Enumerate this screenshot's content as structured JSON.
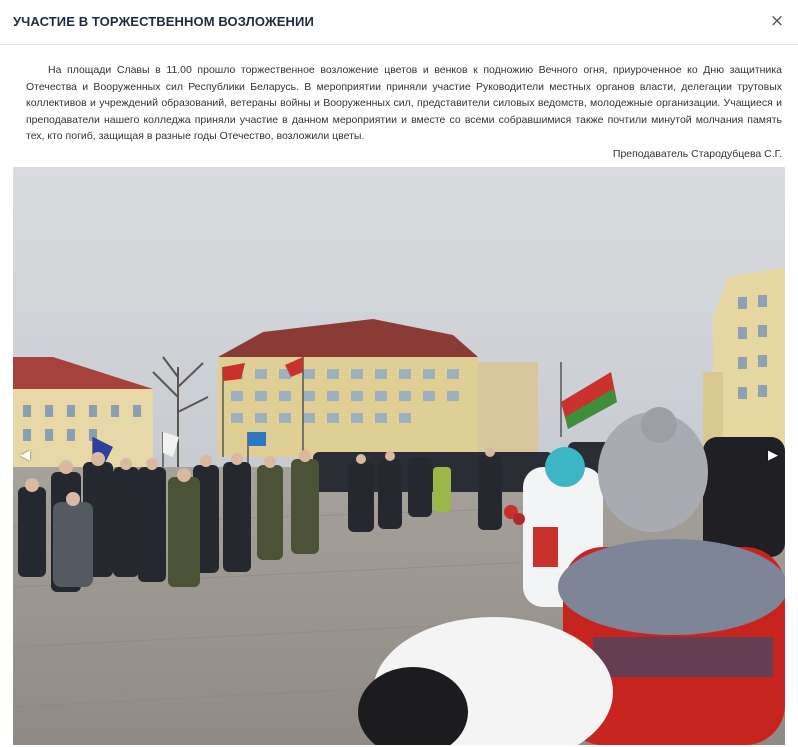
{
  "modal": {
    "title": "УЧАСТИЕ В ТОРЖЕСТВЕННОМ ВОЗЛОЖЕНИИ",
    "close_symbol": "×"
  },
  "article": {
    "text": "На площади Славы в 11.00 прошло торжественное возложение цветов и венков к подножию Вечного огня, приуроченное ко Дню защитника Отечества и Вооруженных сил Республики Беларусь. В мероприятии приняли участие Руководители местных органов власти, делегации трутовых коллективов и учреждений образований, ветераны войны и Вооруженных сил, представители силовых ведомств, молодежные организации. Учащиеся и преподаватели нашего колледжа приняли участие в данном мероприятии и вместе со всеми собравшимися также почтили минутой молчания память тех, кто погиб, защищая в разные годы Отечество, возложили цветы.",
    "author": "Преподаватель Стародубцева С.Г."
  },
  "gallery": {
    "prev_symbol": "◀",
    "next_symbol": "▶",
    "icons": {
      "prev": "chevron-left-icon",
      "next": "chevron-right-icon",
      "close": "close-icon"
    }
  },
  "colors": {
    "title": "#1f2a44",
    "flag_red": "#c8312c",
    "flag_green": "#3f8f3a",
    "sky": "#d3d6da"
  }
}
